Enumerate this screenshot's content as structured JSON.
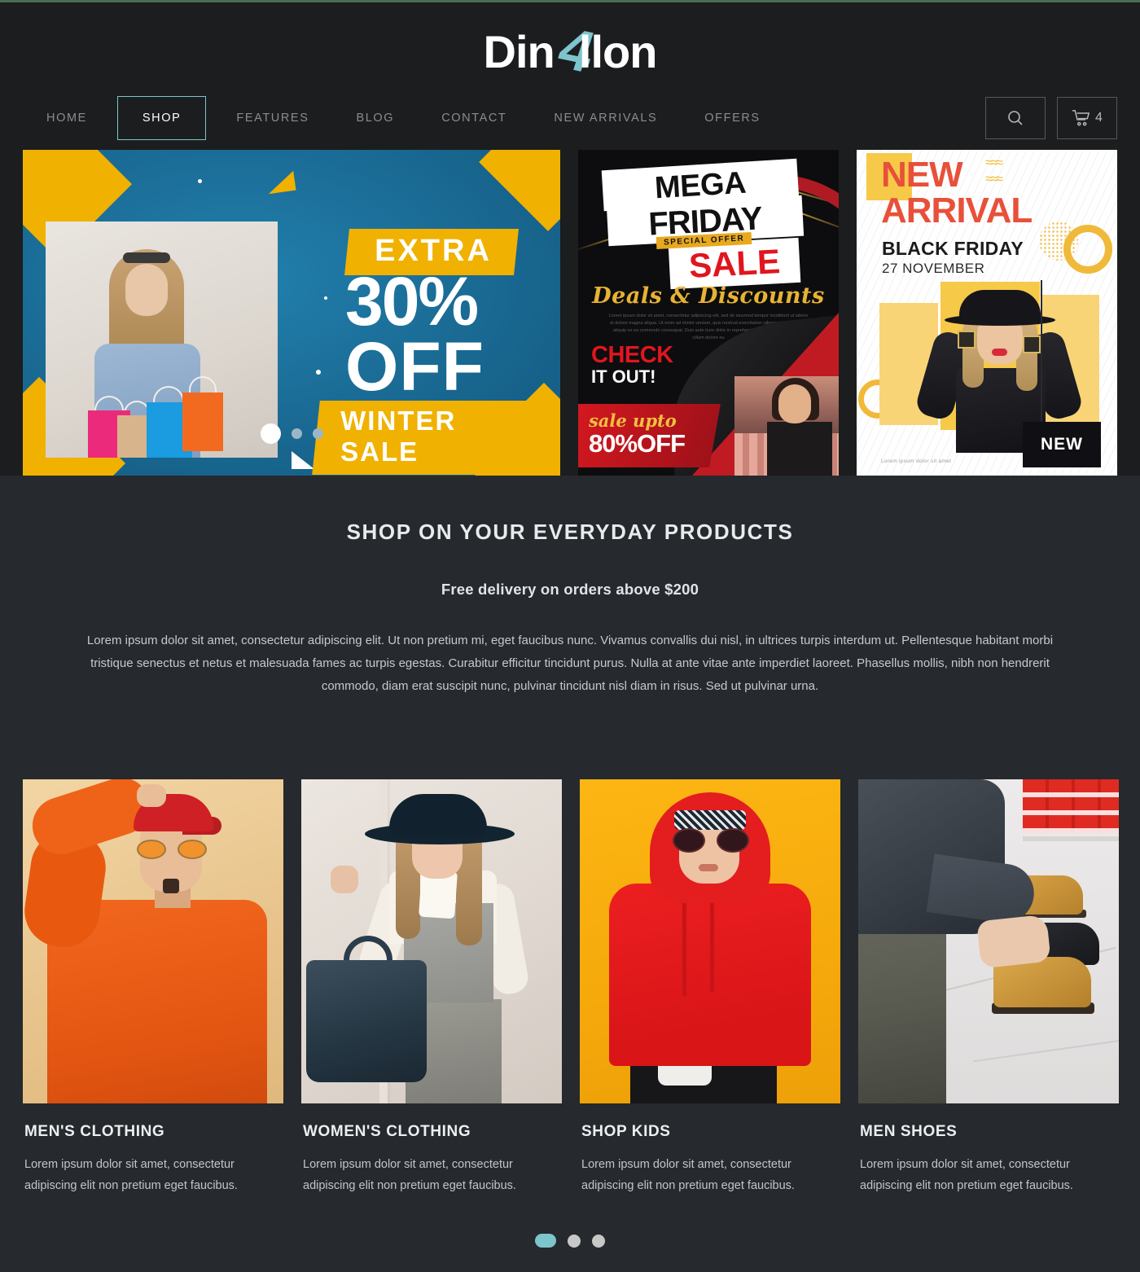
{
  "brand": {
    "name_part1": "Din",
    "name_accent": "4",
    "name_part2": "llon"
  },
  "nav": {
    "items": [
      {
        "label": "HOME",
        "active": false
      },
      {
        "label": "SHOP",
        "active": true
      },
      {
        "label": "FEATURES",
        "active": false
      },
      {
        "label": "BLOG",
        "active": false
      },
      {
        "label": "CONTACT",
        "active": false
      },
      {
        "label": "NEW ARRIVALS",
        "active": false
      },
      {
        "label": "OFFERS",
        "active": false
      }
    ],
    "search_icon": "search-icon",
    "cart_icon": "cart-icon",
    "cart_count": "4"
  },
  "hero": {
    "banner1": {
      "eyebrow": "EXTRA",
      "percent": "30%",
      "off": "OFF",
      "footer": "WINTER SALE",
      "dots": 3,
      "active_dot": 0
    },
    "banner2": {
      "line1": "MEGA",
      "line2": "FRIDAY",
      "tag": "SPECIAL OFFER",
      "line3": "SALE",
      "subtitle": "Deals & Discounts",
      "body": "Lorem ipsum dolor sit amet, consectetur adipiscing elit, sed do eiusmod tempor incididunt ut labore et dolore magna aliqua. Ut enim ad minim veniam, quis nostrud exercitation ullamco laboris nisi ut aliquip ex ea commodo consequat. Duis aute irure dolor in reprehenderit in voluptate velit esse cillum dolore eu",
      "cta1": "CHECK",
      "cta2": "IT OUT!",
      "sale_label": "sale upto",
      "sale_value": "80%OFF"
    },
    "banner3": {
      "line1": "NEW",
      "line2": "ARRIVAL",
      "subtitle": "BLACK FRIDAY",
      "date": "27 NOVEMBER",
      "badge": "NEW",
      "footnote": "Lorem ipsum dolor sit amet"
    }
  },
  "promo": {
    "heading": "SHOP ON YOUR EVERYDAY PRODUCTS",
    "subheading": "Free delivery on orders above $200",
    "paragraph": "Lorem ipsum dolor sit amet, consectetur adipiscing elit. Ut non pretium mi, eget faucibus nunc. Vivamus convallis dui nisl, in ultrices turpis interdum ut. Pellentesque habitant morbi tristique senectus et netus et malesuada fames ac turpis egestas. Curabitur efficitur tincidunt purus. Nulla at ante vitae ante imperdiet laoreet. Phasellus mollis, nibh non hendrerit commodo, diam erat suscipit nunc, pulvinar tincidunt nisl diam in risus. Sed ut pulvinar urna."
  },
  "categories": [
    {
      "title": "MEN'S CLOTHING",
      "description": "Lorem ipsum dolor sit amet, consectetur adipiscing elit non pretium eget faucibus."
    },
    {
      "title": "WOMEN'S CLOTHING",
      "description": "Lorem ipsum dolor sit amet, consectetur adipiscing elit non pretium eget faucibus."
    },
    {
      "title": "SHOP KIDS",
      "description": "Lorem ipsum dolor sit amet, consectetur adipiscing elit non pretium eget faucibus."
    },
    {
      "title": "MEN SHOES",
      "description": "Lorem ipsum dolor sit amet, consectetur adipiscing elit non pretium eget faucibus."
    }
  ],
  "pagination": {
    "total": 3,
    "active": 0
  },
  "colors": {
    "accent_teal": "#7ec4cd",
    "header_bg": "#1b1d1f",
    "section_bg": "#26292d",
    "banner_blue": "#1b6f9c",
    "banner_yellow": "#f0b100",
    "sale_red": "#e0161e"
  }
}
